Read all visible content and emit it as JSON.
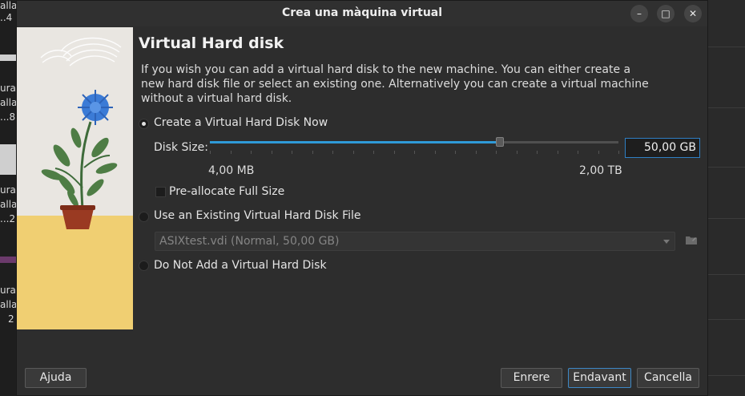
{
  "background": {
    "left_fragments": [
      "alla",
      "..4",
      "ura",
      "alla",
      "...8",
      "ura",
      "alla",
      "...2",
      "ura",
      "alla",
      "2"
    ]
  },
  "window": {
    "title": "Crea una màquina virtual",
    "controls": {
      "minimize": "–",
      "maximize": "□",
      "close": "✕"
    }
  },
  "page": {
    "heading": "Virtual Hard disk",
    "description": "If you wish you can add a virtual hard disk to the new machine. You can either create a new hard disk file or select an existing one. Alternatively you can create a virtual machine without a virtual hard disk."
  },
  "options": {
    "create_new": {
      "label": "Create a Virtual Hard Disk Now",
      "selected": true
    },
    "disk_size": {
      "label": "Disk Size:",
      "value": "50,00 GB",
      "min_label": "4,00 MB",
      "max_label": "2,00 TB",
      "slider_fraction": 0.71
    },
    "preallocate": {
      "label": "Pre-allocate Full Size",
      "checked": false
    },
    "use_existing": {
      "label": "Use an Existing Virtual Hard Disk File",
      "selected": false
    },
    "existing_file": {
      "value": "ASIXtest.vdi (Normal, 50,00 GB)"
    },
    "no_disk": {
      "label": "Do Not Add a Virtual Hard Disk",
      "selected": false
    }
  },
  "buttons": {
    "help": "Ajuda",
    "back": "Enrere",
    "next": "Endavant",
    "cancel": "Cancella"
  },
  "colors": {
    "accent": "#2f9ad8",
    "illustration_bg": "#e9e6e1",
    "illustration_floor": "#f0cf72"
  }
}
